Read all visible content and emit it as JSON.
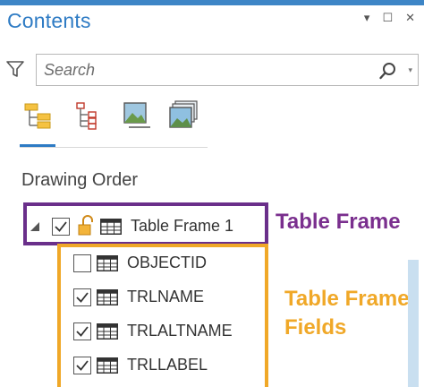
{
  "pane": {
    "title": "Contents",
    "controls": {
      "pin": "▾",
      "maximize": "☐",
      "close": "✕"
    }
  },
  "search": {
    "placeholder": "Search"
  },
  "view_tabs": [
    {
      "name": "list-by-drawing-order",
      "icon": "drawing-order-icon",
      "selected": true
    },
    {
      "name": "list-by-source",
      "icon": "source-icon",
      "selected": false
    },
    {
      "name": "list-by-selection",
      "icon": "selection-icon",
      "selected": false
    },
    {
      "name": "list-by-snapping",
      "icon": "snapping-icon",
      "selected": false
    }
  ],
  "section": {
    "title": "Drawing Order"
  },
  "tree": {
    "frame": {
      "label": "Table Frame 1",
      "checked": true,
      "locked": true
    },
    "fields": [
      {
        "label": "OBJECTID",
        "checked": false
      },
      {
        "label": "TRLNAME",
        "checked": true
      },
      {
        "label": "TRLALTNAME",
        "checked": true
      },
      {
        "label": "TRLLABEL",
        "checked": true
      }
    ]
  },
  "annotations": {
    "frame": "Table Frame",
    "fields_line1": "Table Frame",
    "fields_line2": "Fields"
  },
  "colors": {
    "accent_blue": "#2e7bc4",
    "frame_purple": "#6a2f8a",
    "fields_orange": "#f0a828"
  }
}
